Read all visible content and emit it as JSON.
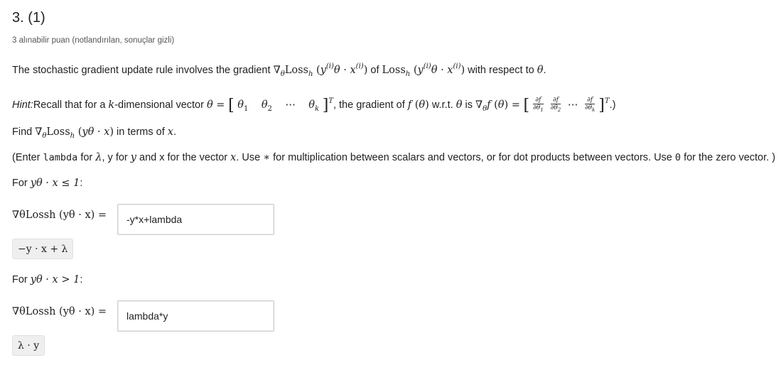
{
  "question": {
    "title": "3. (1)",
    "points": "3 alınabilir puan (notlandırılan, sonuçlar gizli)",
    "intro": {
      "a": "The stochastic gradient update rule involves the gradient ",
      "b": " of ",
      "c": " with respect to ",
      "theta": "θ",
      "d": "."
    },
    "hint": {
      "label": "Hint:",
      "a": "Recall that for a ",
      "k": "k",
      "b": "-dimensional vector ",
      "c": ", the gradient of ",
      "d": " w.r.t. ",
      "e": " is ",
      "f": ".)"
    },
    "find": {
      "a": "Find ",
      "b": " in terms of ",
      "x": "x",
      "c": "."
    },
    "enter_note": {
      "a": "(Enter ",
      "lambda_code": "lambda",
      "b": " for ",
      "lam": "λ",
      "c": ", y for ",
      "y": "y",
      "d": " and x for the vector ",
      "x": "x",
      "e": ". Use ",
      "star": "∗",
      "f": " for multiplication between scalars and vectors, or for dot products between vectors. Use ",
      "zero_code": "0",
      "g": " for the zero vector. )"
    },
    "case1": {
      "label_a": "For ",
      "condition": "yθ · x ≤ 1",
      "label_b": ":",
      "lhs": "∇θLossh (yθ · x) =",
      "input_value": "-y*x+lambda",
      "preview": "−y · x + λ"
    },
    "case2": {
      "label_a": "For ",
      "condition": "yθ · x > 1",
      "label_b": ":",
      "lhs": "∇θLossh (yθ · x) =",
      "input_value": "lambda*y",
      "preview": "λ · y"
    }
  }
}
